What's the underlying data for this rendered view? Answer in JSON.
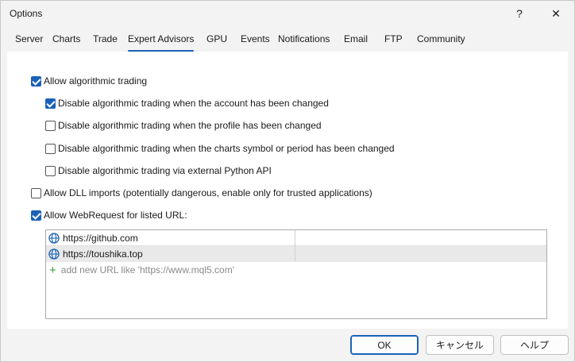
{
  "window": {
    "title": "Options",
    "help_glyph": "?",
    "close_glyph": "✕"
  },
  "tabs": [
    {
      "label": "Server"
    },
    {
      "label": "Charts"
    },
    {
      "label": "Trade"
    },
    {
      "label": "Expert Advisors",
      "active": true
    },
    {
      "label": "GPU"
    },
    {
      "label": "Events"
    },
    {
      "label": "Notifications"
    },
    {
      "label": "Email"
    },
    {
      "label": "FTP"
    },
    {
      "label": "Community"
    }
  ],
  "options": {
    "allow_algo": {
      "label": "Allow algorithmic trading",
      "checked": true
    },
    "disable_account": {
      "label": "Disable algorithmic trading when the account has been changed",
      "checked": true
    },
    "disable_profile": {
      "label": "Disable algorithmic trading when the profile has been changed",
      "checked": false
    },
    "disable_symbol": {
      "label": "Disable algorithmic trading when the charts symbol or period has been changed",
      "checked": false
    },
    "disable_python": {
      "label": "Disable algorithmic trading via external Python API",
      "checked": false
    },
    "allow_dll": {
      "label": "Allow DLL imports (potentially dangerous, enable only for trusted applications)",
      "checked": false
    },
    "allow_webrequest": {
      "label": "Allow WebRequest for listed URL:",
      "checked": true
    }
  },
  "urls": [
    {
      "url": "https://github.com"
    },
    {
      "url": "https://toushika.top"
    }
  ],
  "add_url_placeholder": "add new URL like 'https://www.mql5.com'",
  "add_icon_glyph": "+",
  "buttons": {
    "ok": "OK",
    "cancel": "キャンセル",
    "help": "ヘルプ"
  },
  "colors": {
    "accent": "#1a62b8",
    "globe": "#1a62b8",
    "plus": "#3a9a3a"
  }
}
